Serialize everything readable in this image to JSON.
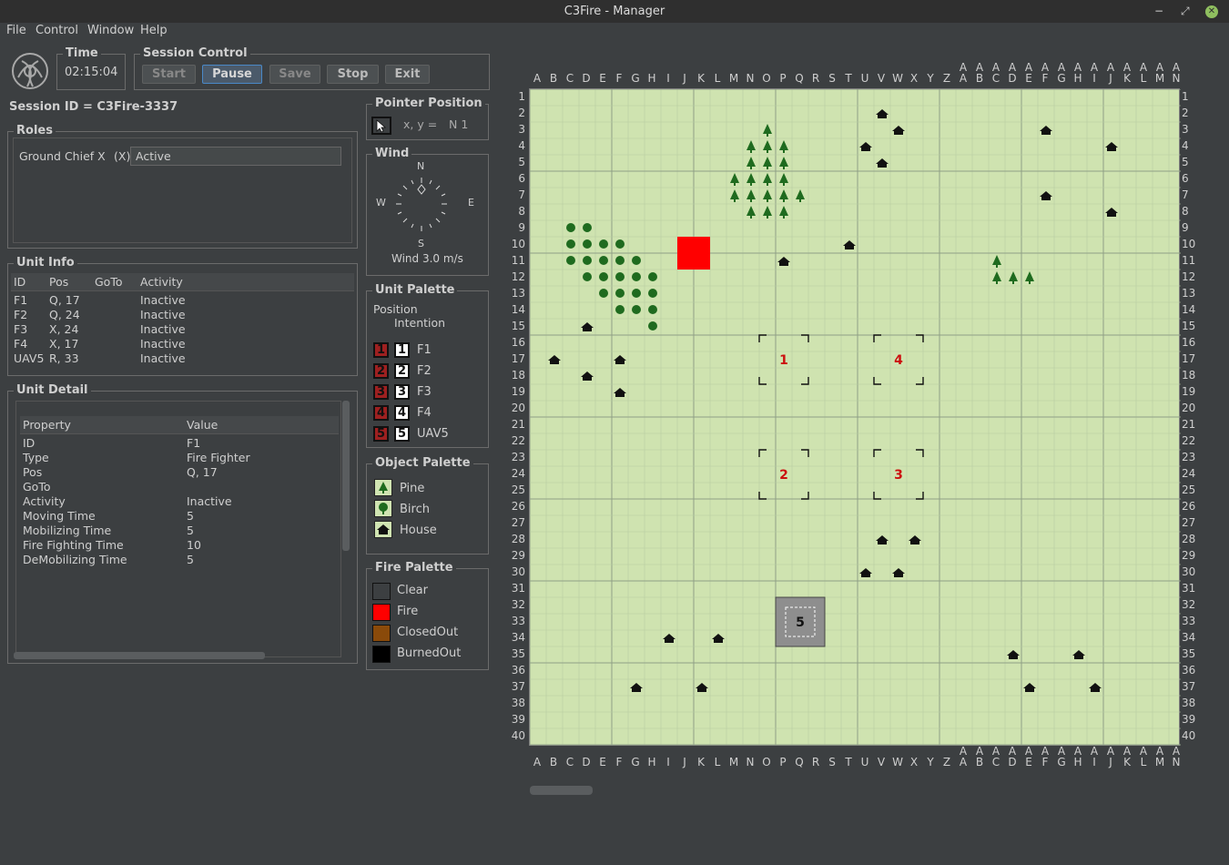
{
  "window": {
    "title": "C3Fire - Manager",
    "min": "−",
    "max": "⤢",
    "close": "✕"
  },
  "menu": [
    "File",
    "Control",
    "Window",
    "Help"
  ],
  "time": {
    "title": "Time",
    "value": "02:15:04"
  },
  "session_control": {
    "title": "Session Control",
    "buttons": [
      "Start",
      "Pause",
      "Save",
      "Stop",
      "Exit"
    ]
  },
  "session_id": "Session ID = C3Fire-3337",
  "roles": {
    "title": "Roles",
    "role": "Ground Chief X",
    "key": "(X)",
    "status": "Active"
  },
  "unit_info": {
    "title": "Unit Info",
    "headers": [
      "ID",
      "Pos",
      "GoTo",
      "Activity"
    ],
    "rows": [
      [
        "F1",
        "Q, 17",
        "",
        "Inactive"
      ],
      [
        "F2",
        "Q, 24",
        "",
        "Inactive"
      ],
      [
        "F3",
        "X, 24",
        "",
        "Inactive"
      ],
      [
        "F4",
        "X, 17",
        "",
        "Inactive"
      ],
      [
        "UAV5",
        "R, 33",
        "",
        "Inactive"
      ]
    ]
  },
  "unit_detail": {
    "title": "Unit Detail",
    "headers": [
      "Property",
      "Value"
    ],
    "rows": [
      [
        "ID",
        "F1"
      ],
      [
        "Type",
        "Fire Fighter"
      ],
      [
        "Pos",
        "Q, 17"
      ],
      [
        "GoTo",
        ""
      ],
      [
        "Activity",
        "Inactive"
      ],
      [
        "Moving Time",
        "5"
      ],
      [
        "Mobilizing Time",
        "5"
      ],
      [
        "Fire Fighting Time",
        "10"
      ],
      [
        "DeMobilizing Time",
        "5"
      ]
    ]
  },
  "pointer": {
    "title": "Pointer Position",
    "label": "x, y =",
    "value": "N 1"
  },
  "wind": {
    "title": "Wind",
    "n": "N",
    "s": "S",
    "e": "E",
    "w": "W",
    "speed": "Wind 3.0 m/s"
  },
  "unit_palette": {
    "title": "Unit Palette",
    "position": "Position",
    "intention": "Intention",
    "units": [
      [
        "1",
        "F1"
      ],
      [
        "2",
        "F2"
      ],
      [
        "3",
        "F3"
      ],
      [
        "4",
        "F4"
      ],
      [
        "5",
        "UAV5"
      ]
    ]
  },
  "object_palette": {
    "title": "Object Palette",
    "items": [
      "Pine",
      "Birch",
      "House"
    ]
  },
  "fire_palette": {
    "title": "Fire Palette",
    "items": [
      "Clear",
      "Fire",
      "ClosedOut",
      "BurnedOut"
    ],
    "colors": [
      "#3c3f41",
      "#ff0000",
      "#8a4a0a",
      "#000000"
    ]
  },
  "map": {
    "cols": [
      "A",
      "B",
      "C",
      "D",
      "E",
      "F",
      "G",
      "H",
      "I",
      "J",
      "K",
      "L",
      "M",
      "N",
      "O",
      "P",
      "Q",
      "R",
      "S",
      "T",
      "U",
      "V",
      "W",
      "X",
      "Y",
      "Z",
      "AA",
      "AB",
      "AC",
      "AD",
      "AE",
      "AF",
      "AG",
      "AH",
      "AI",
      "AJ",
      "AK",
      "AL",
      "AM",
      "AN"
    ],
    "rows": 40,
    "colors": {
      "grass": "#cfe3b0",
      "tree": "#1f6b1f",
      "fire": "#ff0000",
      "house": "#111111"
    },
    "fire": [
      [
        10,
        10
      ],
      [
        11,
        10
      ],
      [
        10,
        11
      ],
      [
        11,
        11
      ]
    ],
    "houses": [
      [
        22,
        2
      ],
      [
        23,
        3
      ],
      [
        21,
        4
      ],
      [
        22,
        5
      ],
      [
        20,
        10
      ],
      [
        16,
        11
      ],
      [
        32,
        3
      ],
      [
        36,
        4
      ],
      [
        36,
        8
      ],
      [
        32,
        7
      ],
      [
        4,
        15
      ],
      [
        2,
        17
      ],
      [
        6,
        17
      ],
      [
        4,
        18
      ],
      [
        6,
        19
      ],
      [
        22,
        28
      ],
      [
        24,
        28
      ],
      [
        21,
        30
      ],
      [
        23,
        30
      ],
      [
        9,
        34
      ],
      [
        12,
        34
      ],
      [
        7,
        37
      ],
      [
        11,
        37
      ],
      [
        30,
        35
      ],
      [
        34,
        35
      ],
      [
        31,
        37
      ],
      [
        35,
        37
      ]
    ],
    "pines": [
      [
        15,
        3
      ],
      [
        14,
        4
      ],
      [
        15,
        4
      ],
      [
        16,
        4
      ],
      [
        14,
        5
      ],
      [
        15,
        5
      ],
      [
        16,
        5
      ],
      [
        13,
        6
      ],
      [
        14,
        6
      ],
      [
        15,
        6
      ],
      [
        16,
        6
      ],
      [
        13,
        7
      ],
      [
        14,
        7
      ],
      [
        15,
        7
      ],
      [
        16,
        7
      ],
      [
        17,
        7
      ],
      [
        14,
        8
      ],
      [
        15,
        8
      ],
      [
        16,
        8
      ],
      [
        29,
        11
      ],
      [
        29,
        12
      ],
      [
        30,
        12
      ],
      [
        31,
        12
      ]
    ],
    "birches": [
      [
        3,
        9
      ],
      [
        4,
        9
      ],
      [
        3,
        10
      ],
      [
        4,
        10
      ],
      [
        5,
        10
      ],
      [
        6,
        10
      ],
      [
        3,
        11
      ],
      [
        4,
        11
      ],
      [
        5,
        11
      ],
      [
        6,
        11
      ],
      [
        7,
        11
      ],
      [
        4,
        12
      ],
      [
        5,
        12
      ],
      [
        6,
        12
      ],
      [
        7,
        12
      ],
      [
        8,
        12
      ],
      [
        5,
        13
      ],
      [
        6,
        13
      ],
      [
        7,
        13
      ],
      [
        8,
        13
      ],
      [
        6,
        14
      ],
      [
        7,
        14
      ],
      [
        8,
        14
      ],
      [
        8,
        15
      ]
    ],
    "units": [
      [
        "1",
        16,
        17
      ],
      [
        "4",
        23,
        17
      ],
      [
        "2",
        16,
        24
      ],
      [
        "3",
        23,
        24
      ]
    ],
    "uav": [
      "5",
      17,
      33
    ]
  }
}
